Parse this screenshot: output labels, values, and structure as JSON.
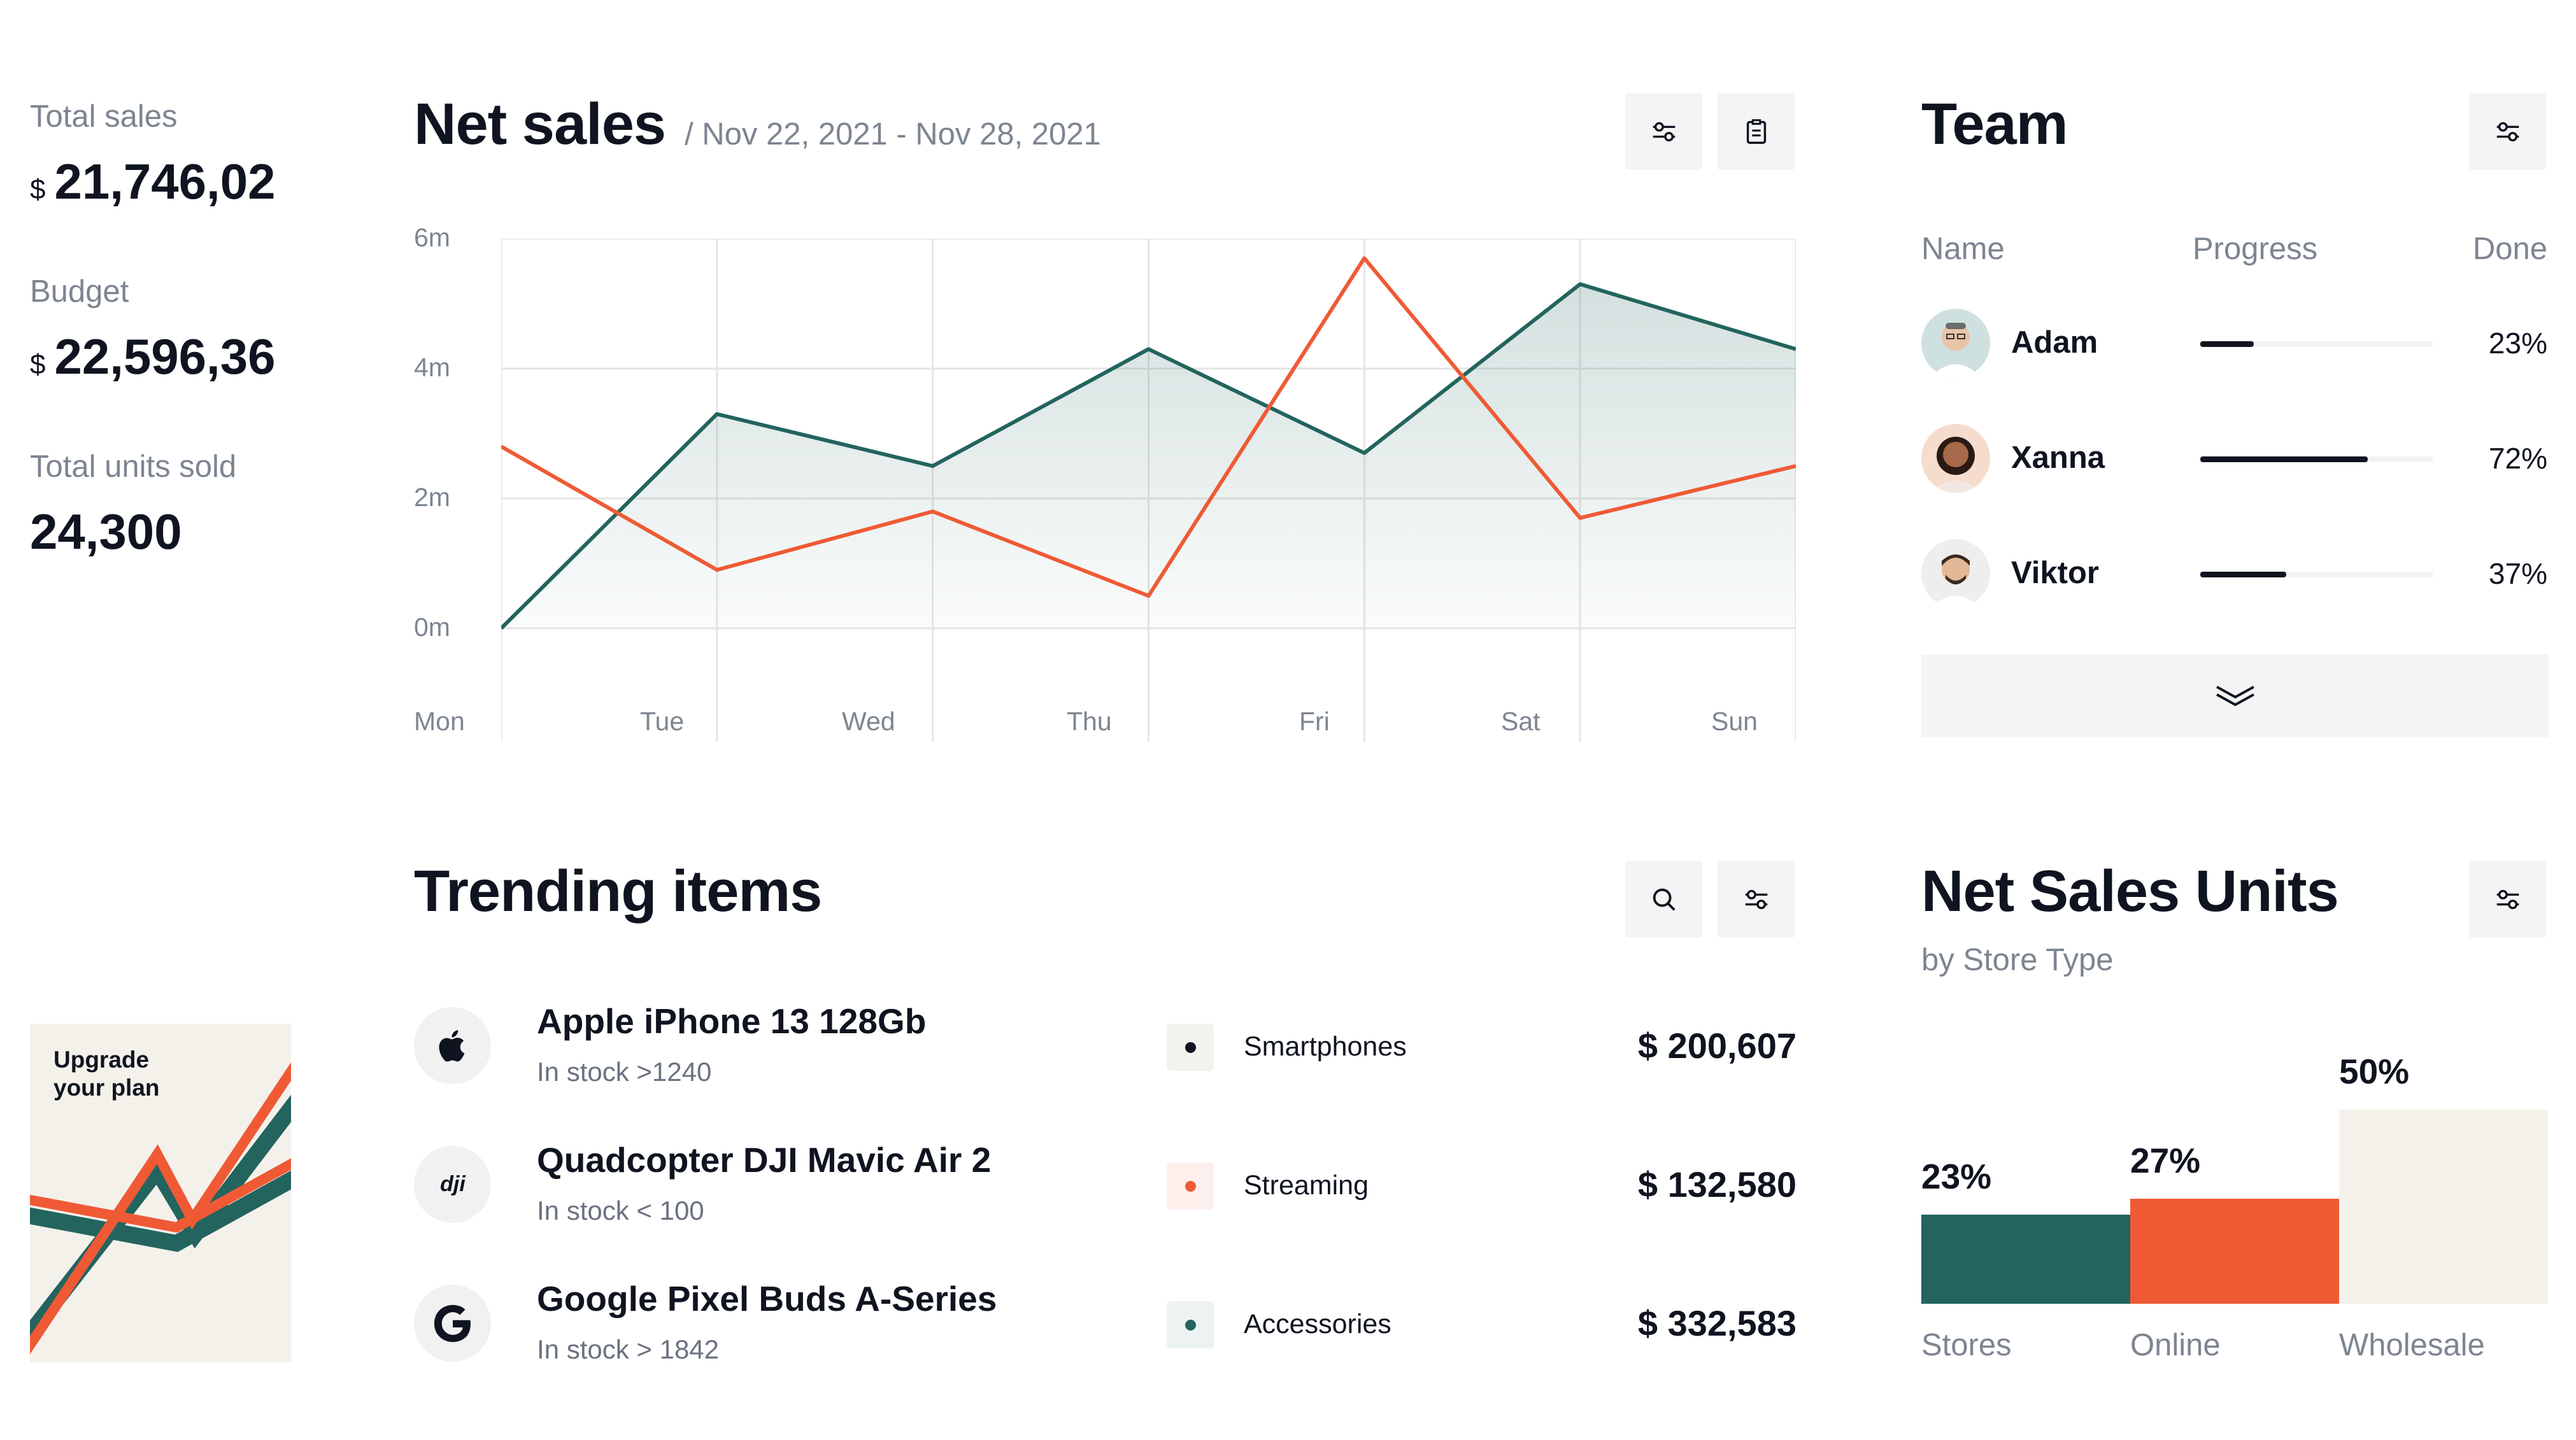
{
  "kpis": {
    "total_sales": {
      "label": "Total sales",
      "currency": "$",
      "value": "21,746,02"
    },
    "budget": {
      "label": "Budget",
      "currency": "$",
      "value": "22,596,36"
    },
    "units": {
      "label": "Total units sold",
      "value": "24,300"
    }
  },
  "upgrade": {
    "line1": "Upgrade",
    "line2": "your plan"
  },
  "net_sales": {
    "title": "Net sales",
    "date_range": "/ Nov 22, 2021 - Nov 28, 2021",
    "icons": [
      "filter-icon",
      "clipboard-icon"
    ]
  },
  "chart_data": {
    "type": "line",
    "categories": [
      "Mon",
      "Tue",
      "Wed",
      "Thu",
      "Fri",
      "Sat",
      "Sun"
    ],
    "y_ticks": [
      "6m",
      "4m",
      "2m",
      "0m"
    ],
    "ylim": [
      0,
      6
    ],
    "series": [
      {
        "color": "#23645e",
        "fill": true,
        "values": [
          0,
          3.3,
          2.5,
          4.3,
          2.7,
          5.3,
          4.3
        ]
      },
      {
        "color": "#ef5a35",
        "fill": false,
        "values": [
          2.8,
          0.9,
          1.8,
          0.5,
          5.7,
          1.7,
          2.5
        ]
      }
    ],
    "grid": true,
    "legend": "none"
  },
  "team": {
    "title": "Team",
    "columns": {
      "name": "Name",
      "progress": "Progress",
      "done": "Done"
    },
    "members": [
      {
        "name": "Adam",
        "progress": 0.23,
        "done": "23%"
      },
      {
        "name": "Xanna",
        "progress": 0.72,
        "done": "72%"
      },
      {
        "name": "Viktor",
        "progress": 0.37,
        "done": "37%"
      }
    ],
    "expand_icon": "chevrons-down-icon"
  },
  "trending": {
    "title": "Trending items",
    "icons": [
      "search-icon",
      "filter-icon"
    ],
    "items": [
      {
        "name": "Apple iPhone 13 128Gb",
        "stock": "In stock >1240",
        "category": "Smartphones",
        "price": "$ 200,607",
        "logo": "apple-logo-icon",
        "dot": "#0f1420",
        "dot_bg": "#f4f2ee"
      },
      {
        "name": "Quadcopter DJI Mavic Air 2",
        "stock": "In stock < 100",
        "category": "Streaming",
        "price": "$ 132,580",
        "logo": "dji-logo-icon",
        "dot": "#ef5a35",
        "dot_bg": "#fdf0ec"
      },
      {
        "name": "Google Pixel Buds A-Series",
        "stock": "In stock > 1842",
        "category": "Accessories",
        "price": "$ 332,583",
        "logo": "google-logo-icon",
        "dot": "#23645e",
        "dot_bg": "#edf3f2"
      }
    ]
  },
  "units_chart": {
    "title": "Net Sales Units",
    "subtitle": "by Store Type",
    "bars": [
      {
        "label": "Stores",
        "pct": "23%",
        "value": 23,
        "color": "#23645e"
      },
      {
        "label": "Online",
        "pct": "27%",
        "value": 27,
        "color": "#ef5a35"
      },
      {
        "label": "Wholesale",
        "pct": "50%",
        "value": 50,
        "color": "#f4f1eb"
      }
    ]
  },
  "colors": {
    "teal": "#23645e",
    "orange": "#ef5a35",
    "cream": "#f4f1eb",
    "ink": "#0f1420"
  }
}
